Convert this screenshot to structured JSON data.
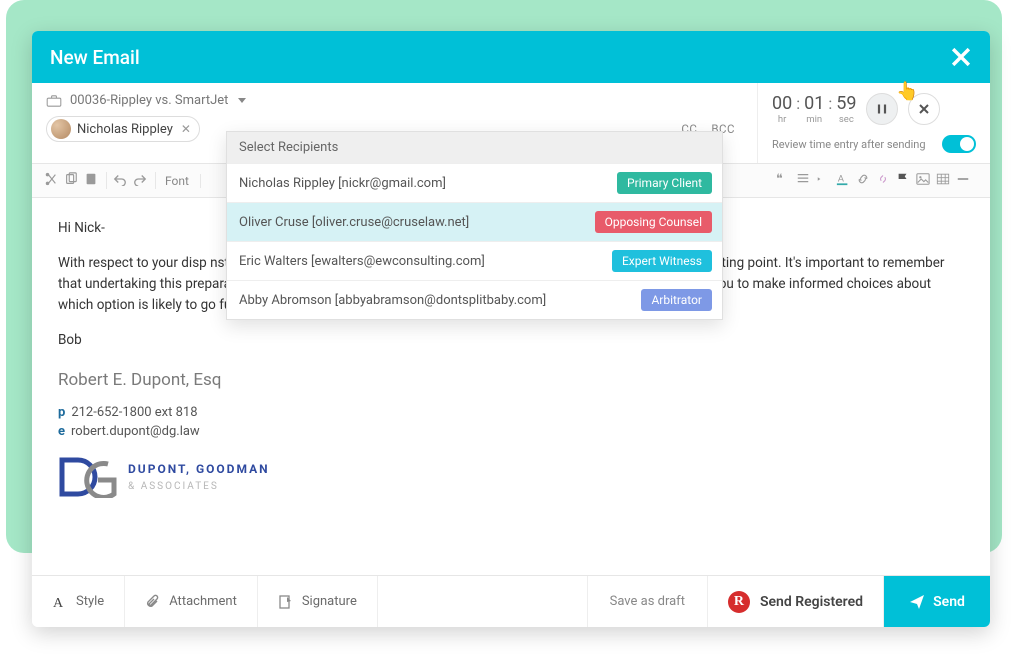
{
  "header": {
    "title": "New Email"
  },
  "case": {
    "label": "00036-Rippley vs. SmartJet"
  },
  "to_chip": {
    "name": "Nicholas Rippley"
  },
  "cc_label": "CC",
  "bcc_label": "BCC",
  "timer": {
    "hr": "00",
    "min": "01",
    "sec": "59",
    "hr_label": "hr",
    "min_label": "min",
    "sec_label": "sec"
  },
  "review_label": "Review time entry after sending",
  "toolbar": {
    "font_label": "Font"
  },
  "recipients": {
    "header": "Select Recipients",
    "items": [
      {
        "text": "Nicholas Rippley [nickr@gmail.com]",
        "badge": "Primary Client",
        "cls": "b-teal",
        "sel": false
      },
      {
        "text": "Oliver Cruse [oliver.cruse@cruselaw.net]",
        "badge": "Opposing Counsel",
        "cls": "b-red",
        "sel": true
      },
      {
        "text": "Eric Walters [ewalters@ewconsulting.com]",
        "badge": "Expert Witness",
        "cls": "b-cyan",
        "sel": false
      },
      {
        "text": "Abby Abromson [abbyabramson@dontsplitbaby.com]",
        "badge": "Arbitrator",
        "cls": "b-blue",
        "sel": false
      }
    ]
  },
  "body": {
    "greeting": "Hi Nick-",
    "para": "With respect to your disp                                                                                                                                                     nstances and to outline for you various options available. We tal                                                                                                                                         rvard model as a starting point. It's important to remember that undertaking this preparation does not preclude you from going down any particular path, but it will assist you to make informed choices about which option is likely to go furthest toward satisfying your interests.  See attached document for the details.",
    "signoff": "Bob"
  },
  "signature": {
    "name": "Robert E. Dupont, Esq",
    "phone_prefix": "p",
    "phone": "212-652-1800 ext 818",
    "email_prefix": "e",
    "email": "robert.dupont@dg.law",
    "firm1": "DUPONT, GOODMAN",
    "firm2": "& ASSOCIATES"
  },
  "footer": {
    "style": "Style",
    "attachment": "Attachment",
    "signature": "Signature",
    "save_draft": "Save as draft",
    "send_registered": "Send Registered",
    "send": "Send"
  }
}
